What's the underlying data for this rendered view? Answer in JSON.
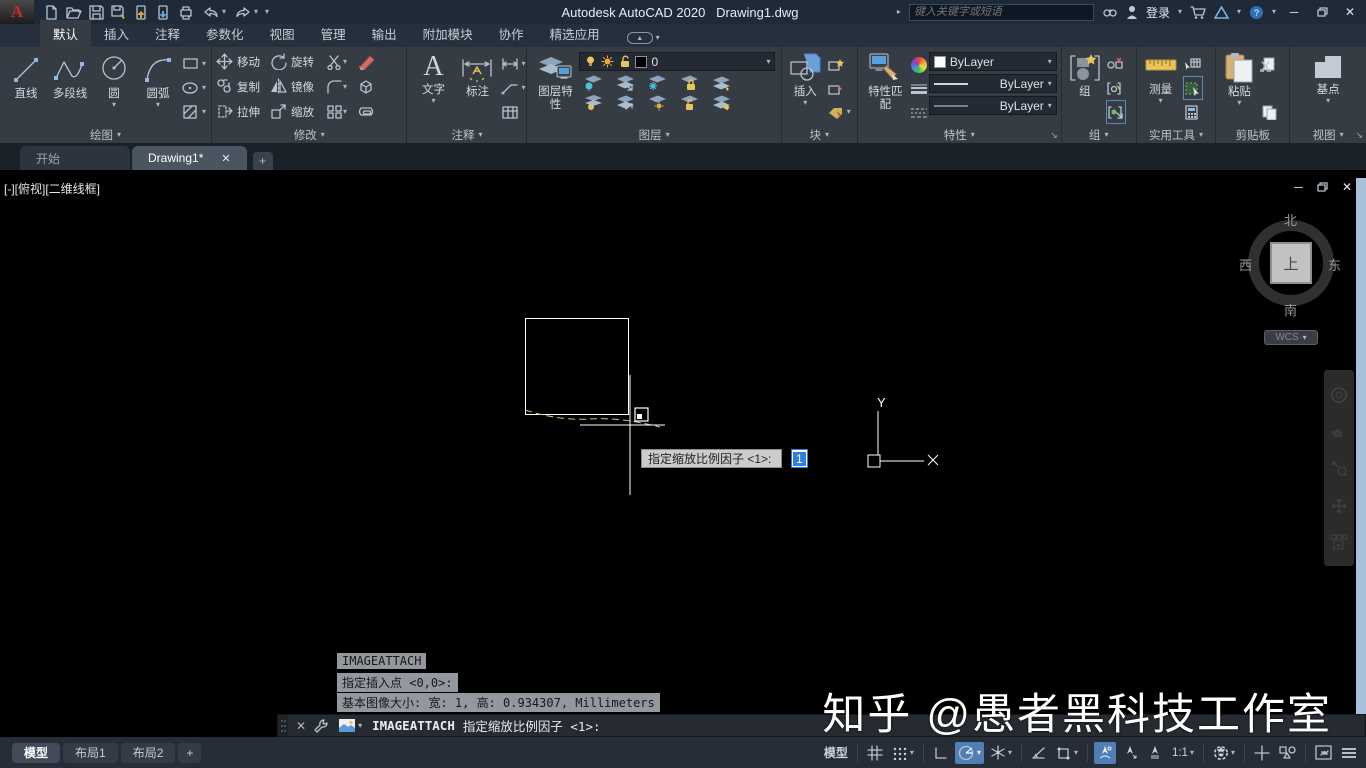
{
  "titlebar": {
    "title": "Autodesk AutoCAD 2020   Drawing1.dwg",
    "search_placeholder": "键入关键字或短语",
    "signin": "登录"
  },
  "ribbon_tabs": [
    {
      "label": "默认",
      "active": true
    },
    {
      "label": "插入"
    },
    {
      "label": "注释"
    },
    {
      "label": "参数化"
    },
    {
      "label": "视图"
    },
    {
      "label": "管理"
    },
    {
      "label": "输出"
    },
    {
      "label": "附加模块"
    },
    {
      "label": "协作"
    },
    {
      "label": "精选应用"
    }
  ],
  "panels": {
    "draw": {
      "b0": "直线",
      "b1": "多段线",
      "b2": "圆",
      "b3": "圆弧",
      "footer": "绘图"
    },
    "modify": {
      "b0": "移动",
      "b1": "旋转",
      "b2": "复制",
      "b3": "镜像",
      "b4": "拉伸",
      "b5": "缩放",
      "footer": "修改"
    },
    "annotate": {
      "b0": "文字",
      "b1": "标注",
      "footer": "注释"
    },
    "layers": {
      "button": "图层特性",
      "layer_name": "0",
      "footer": "图层"
    },
    "block": {
      "button": "插入",
      "footer": "块"
    },
    "properties": {
      "button": "特性匹配",
      "color": "ByLayer",
      "lineweight": "ByLayer",
      "linetype": "ByLayer",
      "footer": "特性"
    },
    "group": {
      "button": "组",
      "footer": "组"
    },
    "utilities": {
      "button": "测量",
      "footer": "实用工具"
    },
    "clipboard": {
      "button": "粘贴",
      "footer": "剪贴板"
    },
    "view": {
      "button": "基点",
      "footer": "视图"
    }
  },
  "file_tabs": {
    "start": "开始",
    "active": "Drawing1*"
  },
  "viewport": {
    "label": "[-][俯视][二维线框]"
  },
  "viewcube": {
    "n": "北",
    "s": "南",
    "e": "东",
    "w": "西",
    "top": "上",
    "wcs": "WCS"
  },
  "drawing": {
    "tooltip_label": "指定缩放比例因子 <1>: ",
    "tooltip_value": "1"
  },
  "command": {
    "history": [
      "IMAGEATTACH",
      "指定插入点 <0,0>:",
      "基本图像大小: 宽: 1, 高: 0.934307, Millimeters"
    ],
    "name": "IMAGEATTACH",
    "prompt": "指定缩放比例因子 <1>:"
  },
  "watermark": "知乎 @愚者黑科技工作室",
  "statusbar": {
    "layouts": {
      "l0": "模型",
      "l1": "布局1",
      "l2": "布局2"
    },
    "model": "模型",
    "scale": "1:1"
  },
  "colors": {
    "accent_blue": "#4f7fb5",
    "scrollbar": "#a9c0dc",
    "selection": "#2f7fe0",
    "ribbon_bg": "#363c44",
    "titlebar_bg": "#1f2a38"
  }
}
